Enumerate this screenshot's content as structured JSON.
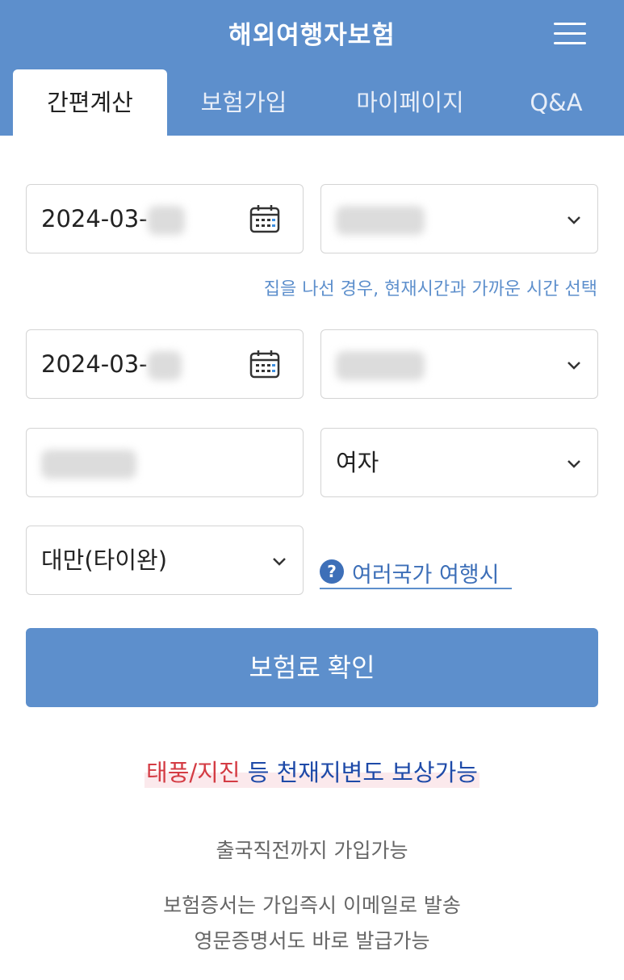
{
  "header": {
    "title": "해외여행자보험",
    "tabs": [
      {
        "label": "간편계산",
        "active": true
      },
      {
        "label": "보험가입",
        "active": false
      },
      {
        "label": "마이페이지",
        "active": false
      },
      {
        "label": "Q&A",
        "active": false
      }
    ]
  },
  "form": {
    "start_date": "2024-03-",
    "end_date": "2024-03-",
    "departure_hint": "집을 나선 경우, 현재시간과 가까운 시간 선택",
    "gender": "여자",
    "country": "대만(타이완)",
    "multi_country_link": "여러국가 여행시"
  },
  "confirm_button": "보험료 확인",
  "banner": {
    "red": "태풍/지진",
    "blue": " 등 천재지변도 보상가능"
  },
  "info": {
    "line1": "출국직전까지 가입가능",
    "line2": "보험증서는 가입즉시 이메일로 발송",
    "line3": "영문증명서도 바로 발급가능"
  },
  "colors": {
    "primary": "#5d8fcc",
    "link": "#3d6fb8",
    "banner_red": "#d43c44",
    "banner_blue": "#1e4aa8"
  },
  "icons": [
    "menu-icon",
    "calendar-icon",
    "chevron-down-icon",
    "question-icon"
  ]
}
